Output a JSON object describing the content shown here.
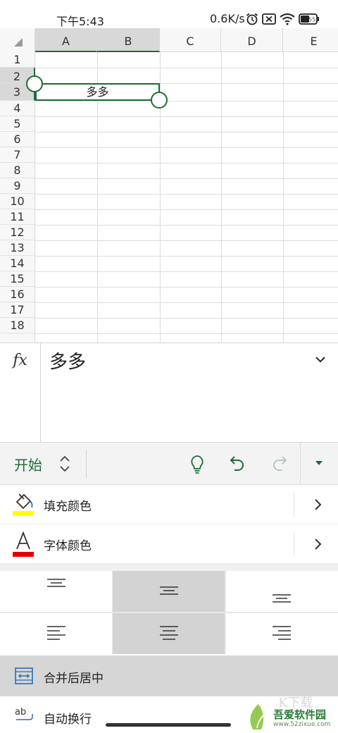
{
  "status_bar": {
    "time": "下午5:43",
    "network_speed": "0.6K/s",
    "battery": "55"
  },
  "sheet": {
    "columns": [
      "A",
      "B",
      "C",
      "D",
      "E"
    ],
    "selected_columns": [
      "A",
      "B"
    ],
    "rows": [
      "1",
      "2",
      "3",
      "4",
      "5",
      "6",
      "7",
      "8",
      "9",
      "10",
      "11",
      "12",
      "13",
      "14",
      "15",
      "16",
      "17",
      "18"
    ],
    "selected_rows": [
      "2",
      "3"
    ],
    "merged_cell_value": "多多"
  },
  "formula_bar": {
    "fx_label": "fx",
    "value": "多多"
  },
  "ribbon": {
    "tab_label": "开始"
  },
  "menu": {
    "fill_color_label": "填充颜色",
    "fill_color": "#ffff00",
    "font_color_label": "字体颜色",
    "font_color": "#e00000",
    "merge_center_label": "合并后居中",
    "wrap_text_label": "自动换行"
  },
  "alignment": {
    "vertical_selected": "middle",
    "horizontal_selected": "center"
  },
  "watermark": {
    "text": "吾爱软件园",
    "url": "www.52zixue.com"
  },
  "colors": {
    "accent_green": "#1e6b35",
    "selection_gray": "#d8d8d8"
  }
}
